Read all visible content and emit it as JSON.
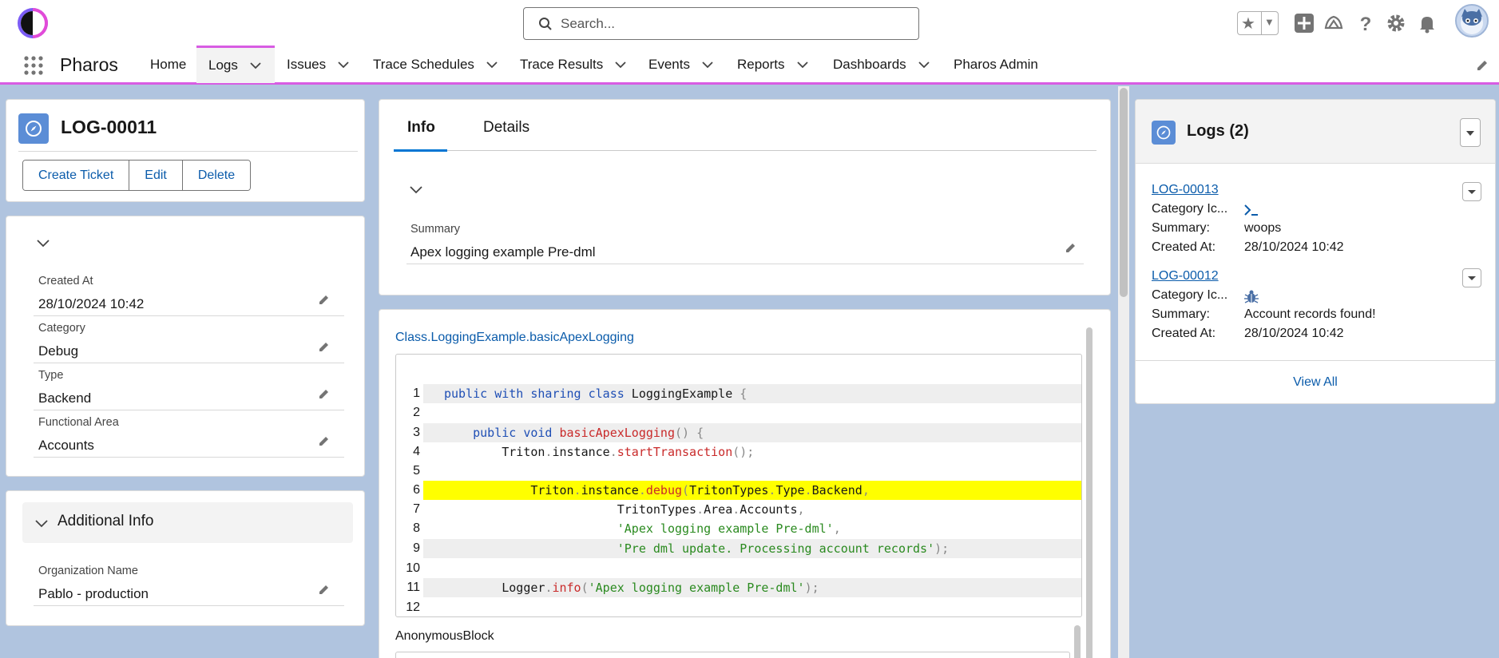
{
  "search": {
    "placeholder": "Search..."
  },
  "nav": {
    "app_name": "Pharos",
    "items": [
      {
        "label": "Home",
        "dropdown": false
      },
      {
        "label": "Logs",
        "dropdown": true,
        "active": true
      },
      {
        "label": "Issues",
        "dropdown": true
      },
      {
        "label": "Trace Schedules",
        "dropdown": true
      },
      {
        "label": "Trace Results",
        "dropdown": true
      },
      {
        "label": "Events",
        "dropdown": true
      },
      {
        "label": "Reports",
        "dropdown": true
      },
      {
        "label": "Dashboards",
        "dropdown": true
      },
      {
        "label": "Pharos Admin",
        "dropdown": false
      }
    ]
  },
  "record": {
    "title": "LOG-00011",
    "actions": [
      "Create Ticket",
      "Edit",
      "Delete"
    ]
  },
  "fields": [
    {
      "label": "Created At",
      "value": "28/10/2024 10:42"
    },
    {
      "label": "Category",
      "value": "Debug"
    },
    {
      "label": "Type",
      "value": "Backend"
    },
    {
      "label": "Functional Area",
      "value": "Accounts"
    }
  ],
  "additional_info": {
    "title": "Additional Info",
    "fields": [
      {
        "label": "Organization Name",
        "value": "Pablo - production"
      }
    ]
  },
  "tabs": [
    "Info",
    "Details"
  ],
  "info": {
    "summary_label": "Summary",
    "summary_value": "Apex logging example Pre-dml"
  },
  "code": {
    "class_link": "Class.LoggingExample.basicApexLogging",
    "line_numbers": [
      "1",
      "2",
      "3",
      "4",
      "5",
      "6",
      "7",
      "8",
      "9",
      "10",
      "11",
      "12"
    ],
    "footer_label": "AnonymousBlock"
  },
  "related": {
    "title": "Logs (2)",
    "labels": {
      "category": "Category Ic...",
      "summary": "Summary:",
      "created": "Created At:"
    },
    "items": [
      {
        "name": "LOG-00013",
        "category_icon": "terminal-icon",
        "summary": "woops",
        "created": "28/10/2024 10:42"
      },
      {
        "name": "LOG-00012",
        "category_icon": "bug-icon",
        "summary": "Account records found!",
        "created": "28/10/2024 10:42"
      }
    ],
    "view_all": "View All"
  },
  "colors": {
    "accent": "#0176d3",
    "nav_active": "#d85ce3",
    "record_icon": "#5b8dd6",
    "highlight": "#ffff00"
  }
}
